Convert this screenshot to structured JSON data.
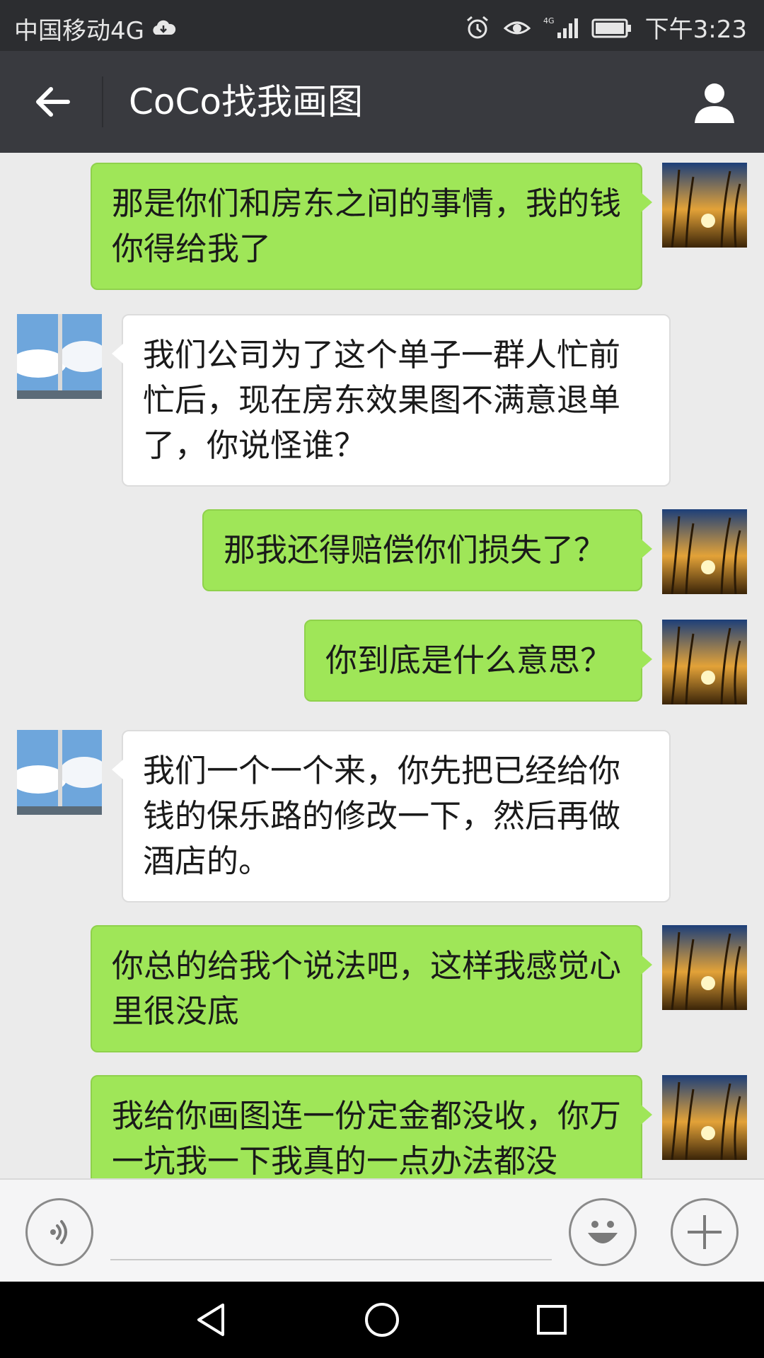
{
  "status_bar": {
    "carrier": "中国移动4G",
    "time": "下午3:23",
    "icons": [
      "cloud-icon",
      "alarm-icon",
      "eye-icon",
      "signal-icon",
      "battery-icon"
    ]
  },
  "header": {
    "title": "CoCo找我画图"
  },
  "messages": [
    {
      "side": "right",
      "text": "那是你们和房东之间的事情，我的钱你得给我了"
    },
    {
      "side": "left",
      "text": "我们公司为了这个单子一群人忙前忙后，现在房东效果图不满意退单了，你说怪谁？"
    },
    {
      "side": "right",
      "text": "那我还得赔偿你们损失了？"
    },
    {
      "side": "right",
      "text": "你到底是什么意思？"
    },
    {
      "side": "left",
      "text": "我们一个一个来，你先把已经给你钱的保乐路的修改一下，然后再做酒店的。"
    },
    {
      "side": "right",
      "text": "你总的给我个说法吧，这样我感觉心里很没底"
    },
    {
      "side": "right",
      "text": "我给你画图连一份定金都没收，你万一坑我一下我真的一点办法都没"
    }
  ],
  "input_bar": {
    "placeholder": "",
    "icons": [
      "voice-icon",
      "emoji-icon",
      "plus-icon"
    ]
  },
  "colors": {
    "status_bg": "#2c2d30",
    "header_bg": "#393a3f",
    "chat_bg": "#ebebeb",
    "bubble_self": "#9fe658",
    "bubble_other": "#ffffff"
  }
}
